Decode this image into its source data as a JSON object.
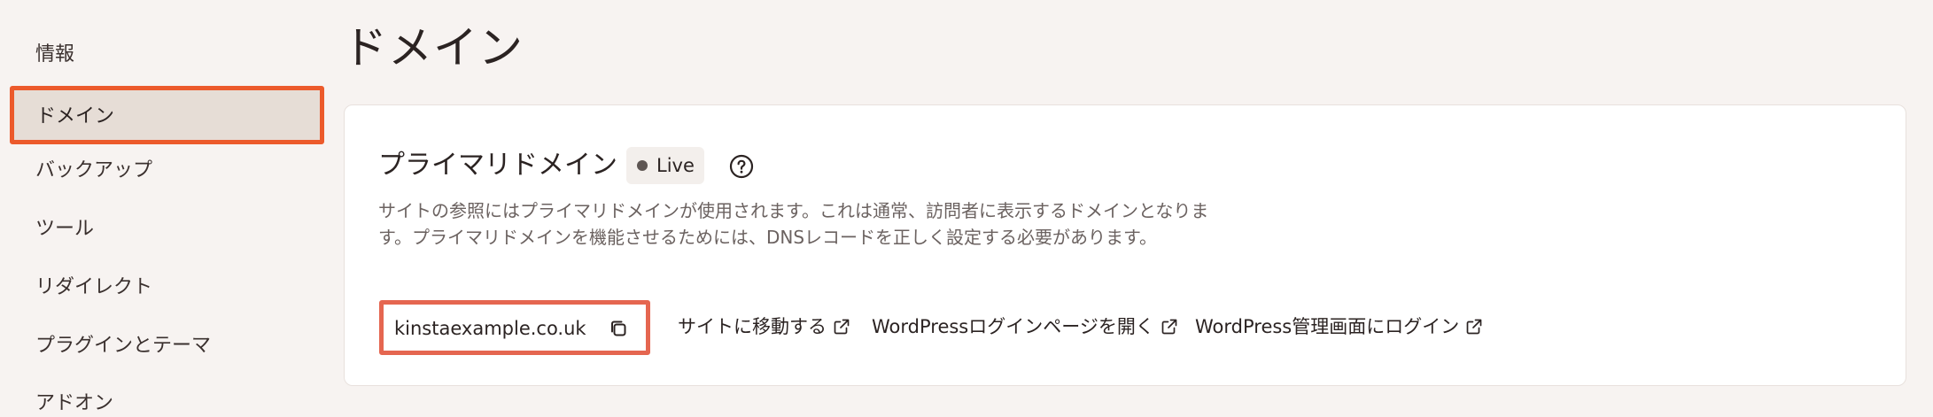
{
  "sidebar": {
    "items": [
      {
        "label": "情報"
      },
      {
        "label": "ドメイン",
        "active": true
      },
      {
        "label": "バックアップ"
      },
      {
        "label": "ツール"
      },
      {
        "label": "リダイレクト"
      },
      {
        "label": "プラグインとテーマ"
      },
      {
        "label": "アドオン"
      }
    ]
  },
  "page": {
    "title": "ドメイン"
  },
  "primary_domain": {
    "title": "プライマリドメイン",
    "status_badge": "Live",
    "help_icon": "question-circle-icon",
    "description": "サイトの参照にはプライマリドメインが使用されます。これは通常、訪問者に表示するドメインとなります。プライマリドメインを機能させるためには、DNSレコードを正しく設定する必要があります。",
    "domain": "kinstaexample.co.uk",
    "copy_icon": "copy-icon",
    "links": [
      {
        "label": "サイトに移動する",
        "icon": "external-link-icon"
      },
      {
        "label": "WordPressログインページを開く",
        "icon": "external-link-icon"
      },
      {
        "label": "WordPress管理画面にログイン",
        "icon": "external-link-icon"
      }
    ]
  },
  "colors": {
    "background": "#f7f3f1",
    "card": "#ffffff",
    "highlight_border": "#ec5a2b",
    "active_bg": "#e6ddd6",
    "muted_text": "#6b6260"
  }
}
